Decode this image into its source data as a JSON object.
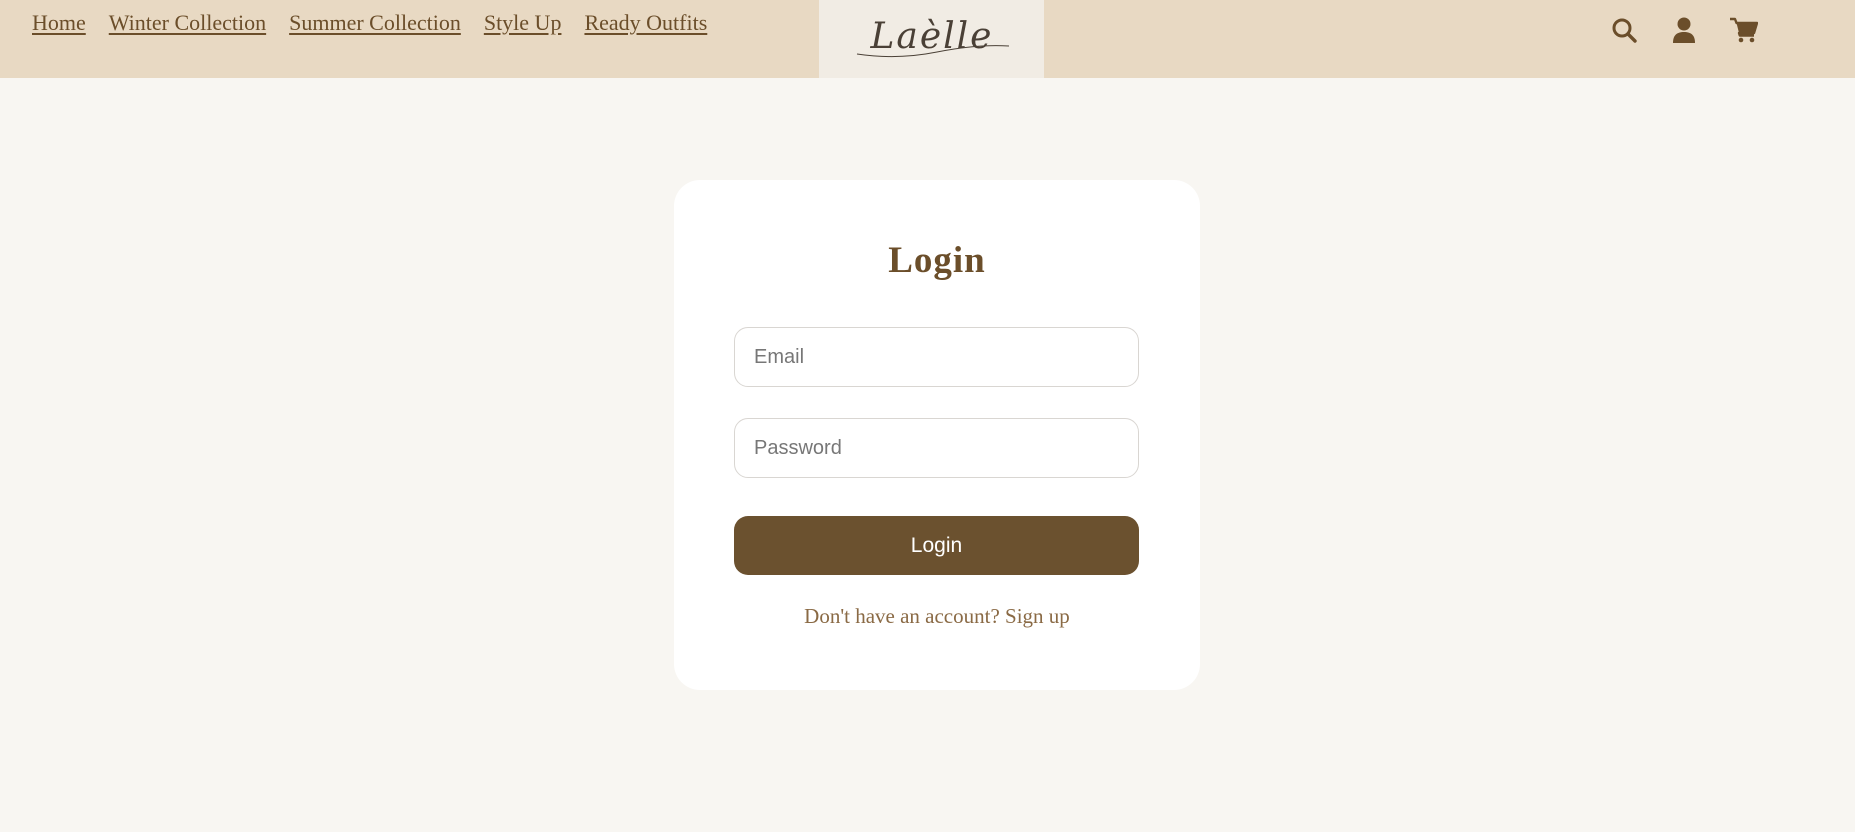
{
  "nav": {
    "items": [
      {
        "label": "Home"
      },
      {
        "label": "Winter Collection"
      },
      {
        "label": "Summer Collection"
      },
      {
        "label": "Style Up"
      },
      {
        "label": "Ready Outfits"
      }
    ]
  },
  "brand": {
    "logo_text": "Laèlle"
  },
  "header_icons": [
    "search-icon",
    "user-icon",
    "cart-icon"
  ],
  "login": {
    "title": "Login",
    "email_placeholder": "Email",
    "password_placeholder": "Password",
    "submit_label": "Login",
    "signup_prompt": "Don't have an account?",
    "signup_link": "Sign up"
  },
  "colors": {
    "header_bg": "#e8d9c3",
    "page_bg": "#f8f6f2",
    "accent": "#6b512f",
    "text_brown": "#6b4e2a"
  }
}
